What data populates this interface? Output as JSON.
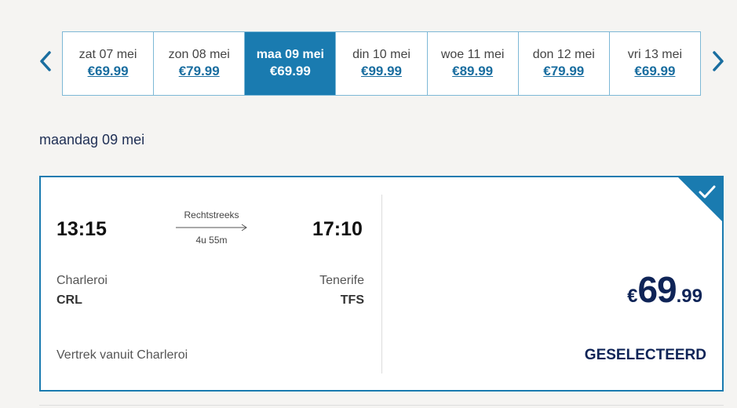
{
  "date_selector": {
    "prev_icon": "chevron-left-icon",
    "next_icon": "chevron-right-icon",
    "dates": [
      {
        "label": "zat 07 mei",
        "price": "€69.99"
      },
      {
        "label": "zon 08 mei",
        "price": "€79.99"
      },
      {
        "label": "maa 09 mei",
        "price": "€69.99",
        "selected": true
      },
      {
        "label": "din 10 mei",
        "price": "€99.99"
      },
      {
        "label": "woe 11 mei",
        "price": "€89.99"
      },
      {
        "label": "don 12 mei",
        "price": "€79.99"
      },
      {
        "label": "vri 13 mei",
        "price": "€69.99"
      }
    ]
  },
  "day_heading": "maandag 09 mei",
  "flight": {
    "departure_time": "13:15",
    "arrival_time": "17:10",
    "route_type": "Rechtstreeks",
    "duration": "4u 55m",
    "departure_city": "Charleroi",
    "departure_code": "CRL",
    "arrival_city": "Tenerife",
    "arrival_code": "TFS",
    "departs_from": "Vertrek vanuit Charleroi",
    "price_currency": "€",
    "price_main": "69",
    "price_cents": ".99",
    "status": "GESELECTEERD",
    "selected_icon": "checkmark-icon"
  },
  "colors": {
    "accent": "#1a7bb0",
    "price_text": "#0f2457",
    "border_light": "#7db8d6"
  }
}
